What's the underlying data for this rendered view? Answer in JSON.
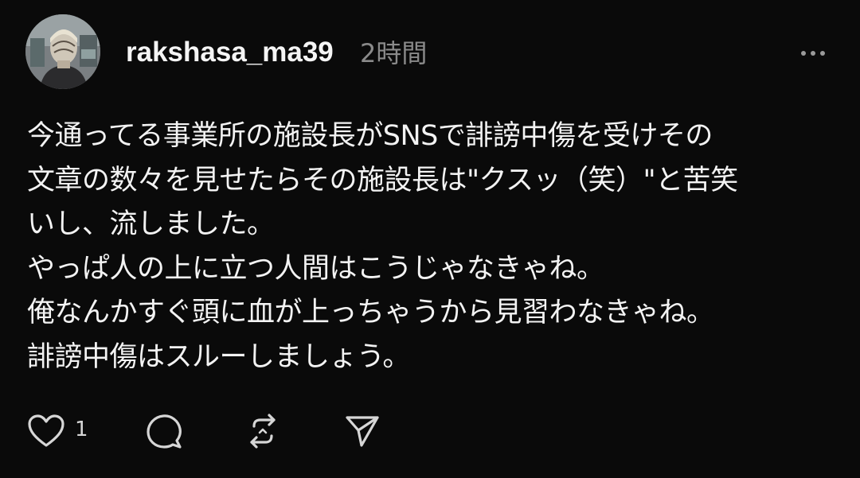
{
  "post": {
    "username": "rakshasa_ma39",
    "timestamp": "2時間",
    "more_icon": "more-horizontal-icon",
    "body_lines": [
      "今通ってる事業所の施設長がSNSで誹謗中傷を受けその",
      "文章の数々を見せたらその施設長は\"クスッ（笑）\"と苦笑",
      "いし、流しました。",
      "やっぱ人の上に立つ人間はこうじゃなきゃね。",
      "俺なんかすぐ頭に血が上っちゃうから見習わなきゃね。",
      "誹謗中傷はスルーしましょう。"
    ]
  },
  "actions": {
    "like_icon": "heart-icon",
    "like_count": "1",
    "comment_icon": "comment-icon",
    "repost_icon": "repost-icon",
    "share_icon": "send-icon"
  },
  "colors": {
    "background": "#0a0a0a",
    "text": "#f3f3f3",
    "muted": "#8a8a8a",
    "icon": "#d6d6d6"
  }
}
